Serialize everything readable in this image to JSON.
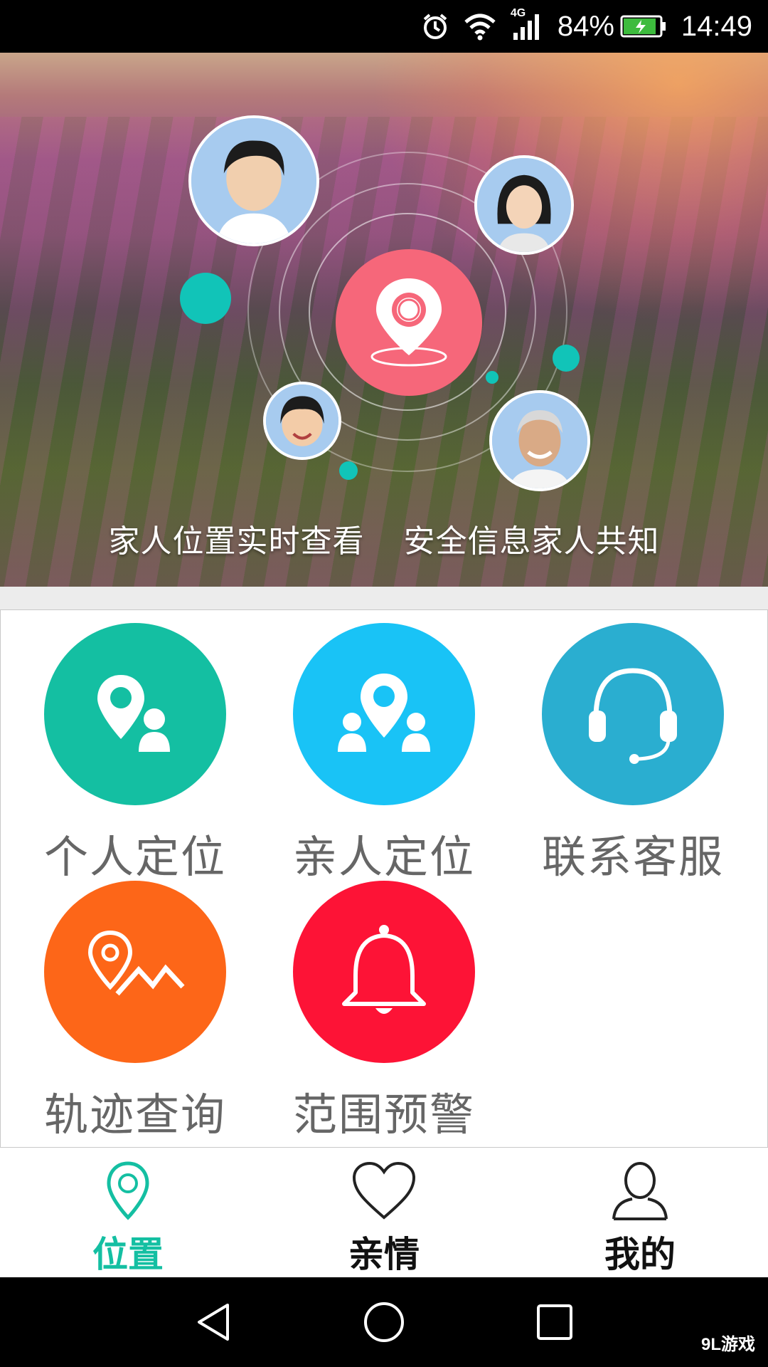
{
  "status_bar": {
    "network": "4G",
    "battery": "84%",
    "time": "14:49"
  },
  "banner": {
    "caption_left": "家人位置实时查看",
    "caption_right": "安全信息家人共知"
  },
  "features": [
    {
      "label": "个人定位",
      "color": "#14bfa2",
      "icon": "person-location-icon"
    },
    {
      "label": "亲人定位",
      "color": "#19c3f6",
      "icon": "family-location-icon"
    },
    {
      "label": "联系客服",
      "color": "#2aaed0",
      "icon": "headset-icon"
    },
    {
      "label": "轨迹查询",
      "color": "#fd6618",
      "icon": "track-icon"
    },
    {
      "label": "范围预警",
      "color": "#fd1336",
      "icon": "bell-icon"
    }
  ],
  "bottom_nav": {
    "items": [
      {
        "label": "位置",
        "active": true,
        "icon": "location-pin-icon"
      },
      {
        "label": "亲情",
        "active": false,
        "icon": "heart-icon"
      },
      {
        "label": "我的",
        "active": false,
        "icon": "user-icon"
      }
    ],
    "active_color": "#14bfa2",
    "inactive_color": "#111111"
  },
  "watermark": "9L游戏"
}
